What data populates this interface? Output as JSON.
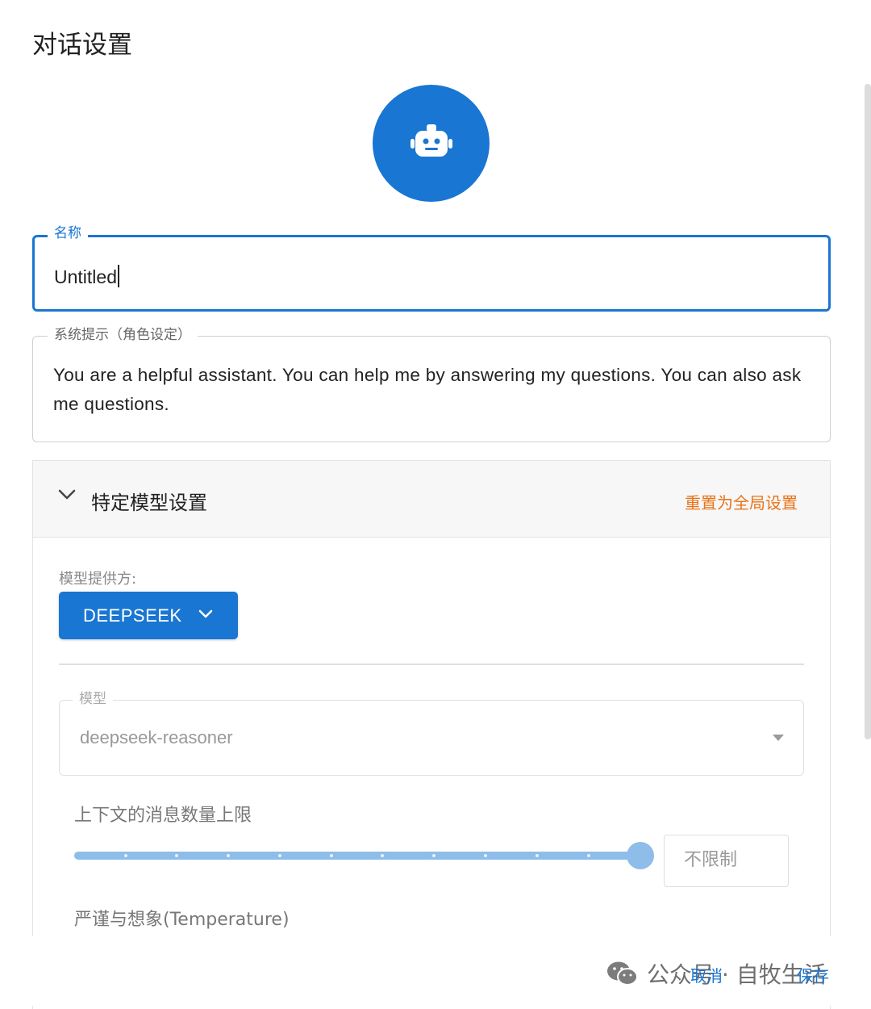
{
  "dialog": {
    "title": "对话设置",
    "avatar_icon": "robot-icon",
    "accent_color": "#1976d2"
  },
  "name_field": {
    "label": "名称",
    "value": "Untitled"
  },
  "system_prompt": {
    "label": "系统提示（角色设定）",
    "value": "You are a helpful assistant. You can help me by answering my questions. You can also ask me questions."
  },
  "model_settings": {
    "title": "特定模型设置",
    "reset_label": "重置为全局设置",
    "reset_color": "#e8731a",
    "provider_label": "模型提供方:",
    "provider_value": "DEEPSEEK",
    "model_label": "模型",
    "model_value": "deepseek-reasoner",
    "context_label": "上下文的消息数量上限",
    "context_slider_fraction": 1.0,
    "context_value": "不限制",
    "temperature_label": "严谨与想象(Temperature)"
  },
  "footer": {
    "watermark": "公众号 · 自牧生活",
    "cancel_label": "取消",
    "save_label": "保存"
  }
}
